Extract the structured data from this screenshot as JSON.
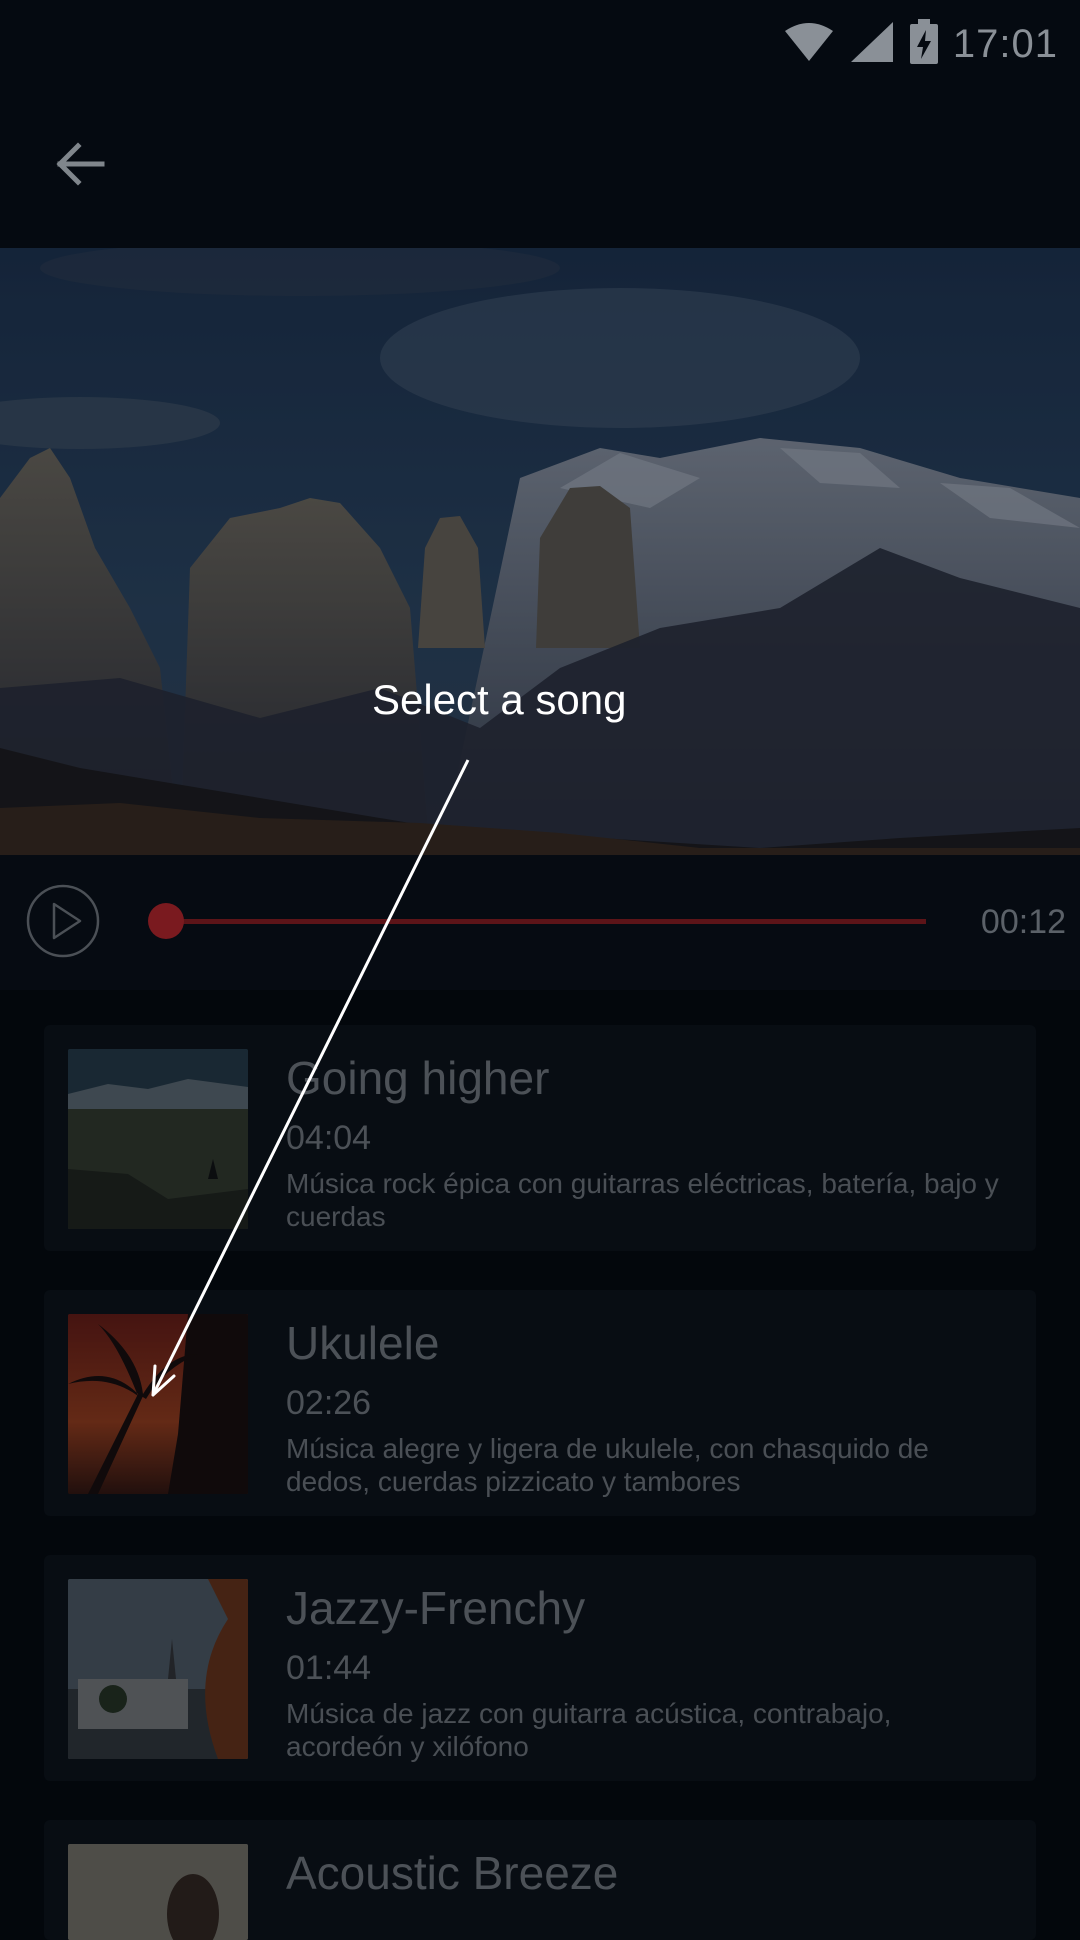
{
  "status_bar": {
    "time": "17:01",
    "icons": [
      "wifi-icon",
      "signal-icon",
      "battery-charging-icon"
    ]
  },
  "app_bar": {
    "back_icon": "arrow-left-icon"
  },
  "player": {
    "play_icon": "play-icon",
    "time": "00:12",
    "progress": 0.0
  },
  "songs": [
    {
      "title": "Going higher",
      "duration": "04:04",
      "description": "Música rock épica con guitarras eléctricas, batería, bajo y cuerdas"
    },
    {
      "title": "Ukulele",
      "duration": "02:26",
      "description": "Música alegre y ligera de ukulele, con chasquido de dedos, cuerdas pizzicato y tambores"
    },
    {
      "title": "Jazzy-Frenchy",
      "duration": "01:44",
      "description": "Música de jazz con guitarra acústica, contrabajo, acordeón y xilófono"
    },
    {
      "title": "Acoustic Breeze",
      "duration": "",
      "description": ""
    }
  ],
  "tutorial": {
    "hint": "Select a song"
  },
  "colors": {
    "accent": "#c62828",
    "background": "#03070c"
  }
}
